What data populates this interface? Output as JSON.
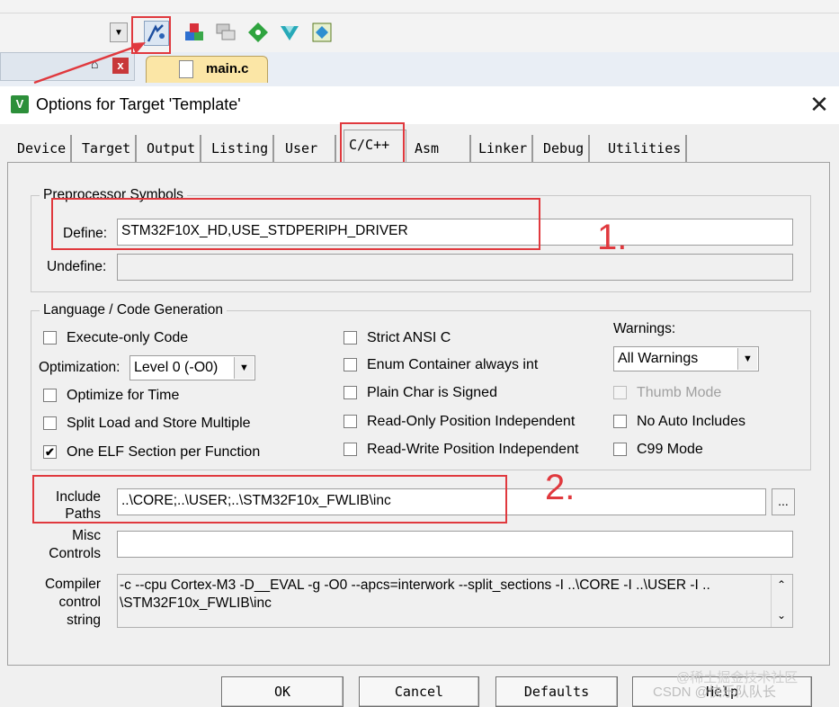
{
  "editor": {
    "tab_label": "main.c",
    "close_small": "x",
    "pin": "⌂"
  },
  "dialog": {
    "title": "Options for Target 'Template'",
    "close_glyph": "✕"
  },
  "tabs": [
    "Device",
    "Target",
    "Output",
    "Listing",
    "User",
    "C/C++",
    "Asm",
    "Linker",
    "Debug",
    "Utilities"
  ],
  "preprocessor": {
    "legend": "Preprocessor Symbols",
    "define_label": "Define:",
    "define_value": "STM32F10X_HD,USE_STDPERIPH_DRIVER",
    "undefine_label": "Undefine:",
    "undefine_value": ""
  },
  "language": {
    "legend": "Language / Code Generation",
    "execute_only": "Execute-only Code",
    "optimization_label": "Optimization:",
    "optimization_value": "Level 0 (-O0)",
    "optimize_time": "Optimize for Time",
    "split_load": "Split Load and Store Multiple",
    "one_elf": "One ELF Section per Function",
    "strict_ansi": "Strict ANSI C",
    "enum_container": "Enum Container always int",
    "plain_char": "Plain Char is Signed",
    "ro_pi": "Read-Only Position Independent",
    "rw_pi": "Read-Write Position Independent",
    "warnings_label": "Warnings:",
    "warnings_value": "All Warnings",
    "thumb_mode": "Thumb Mode",
    "no_auto_includes": "No Auto Includes",
    "c99_mode": "C99 Mode",
    "checked": {
      "one_elf": true
    }
  },
  "include": {
    "label_line1": "Include",
    "label_line2": "Paths",
    "value": "..\\CORE;..\\USER;..\\STM32F10x_FWLIB\\inc",
    "browse": "..."
  },
  "misc": {
    "label_line1": "Misc",
    "label_line2": "Controls",
    "value": ""
  },
  "compiler": {
    "label_line1": "Compiler",
    "label_line2": "control",
    "label_line3": "string",
    "line1": "-c --cpu Cortex-M3 -D__EVAL -g -O0 --apcs=interwork --split_sections -I ..\\CORE -I ..\\USER -I ..",
    "line2": "\\STM32F10x_FWLIB\\inc"
  },
  "buttons": {
    "ok": "OK",
    "cancel": "Cancel",
    "defaults": "Defaults",
    "help": "Help"
  },
  "annotations": {
    "one": "1.",
    "two": "2."
  },
  "watermark": {
    "line1": "@稀土掘金技术社区",
    "line2": "CSDN @快乐队队长"
  },
  "colors": {
    "annotation_red": "#e0393e",
    "keil_green": "#2c8f3a"
  }
}
